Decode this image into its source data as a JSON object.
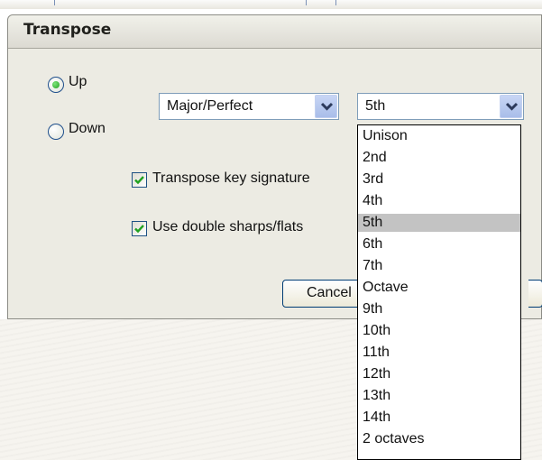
{
  "dialog": {
    "title": "Transpose"
  },
  "direction": {
    "options": [
      {
        "label": "Up",
        "selected": true
      },
      {
        "label": "Down",
        "selected": false
      }
    ]
  },
  "quality_select": {
    "value": "Major/Perfect"
  },
  "interval_select": {
    "value": "5th",
    "options": [
      "Unison",
      "2nd",
      "3rd",
      "4th",
      "5th",
      "6th",
      "7th",
      "Octave",
      "9th",
      "10th",
      "11th",
      "12th",
      "13th",
      "14th",
      "2 octaves"
    ],
    "highlighted": "5th"
  },
  "checkboxes": [
    {
      "label": "Transpose key signature",
      "checked": true
    },
    {
      "label": "Use double sharps/flats",
      "checked": true
    }
  ],
  "buttons": {
    "cancel": "Cancel"
  },
  "icons": {
    "checkmark": "checkmark-icon",
    "dropdown": "chevron-down-icon",
    "radio": "radio-dot-icon"
  },
  "colors": {
    "selection": "#c3c3c3",
    "check_green": "#24a01f",
    "combo_border": "#7f9db9",
    "dropdown_button": "#b9cbef"
  }
}
